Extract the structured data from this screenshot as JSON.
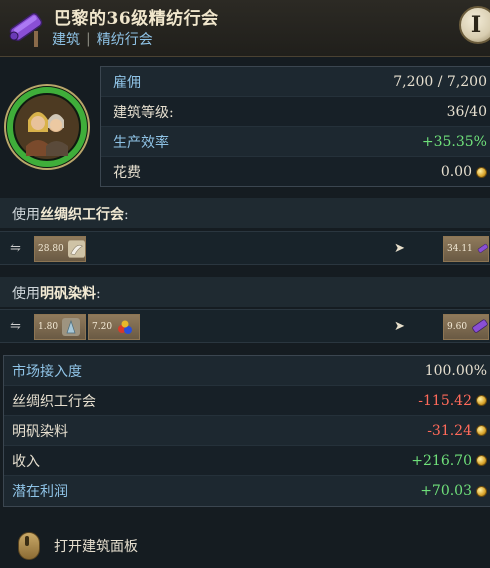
{
  "header": {
    "title": "巴黎的36级精纺行会",
    "crumb1": "建筑",
    "crumb_sep": "|",
    "crumb2": "精纺行会",
    "info_label": "I"
  },
  "stats": [
    {
      "label": "雇佣",
      "value": "7,200 / 7,200"
    },
    {
      "label": "建筑等级:",
      "value": "36/40"
    },
    {
      "label": "生产效率",
      "value": "+35.35%"
    },
    {
      "label": "花费",
      "value": "0.00"
    }
  ],
  "sections": {
    "silk": {
      "prefix": "使用",
      "name": "丝绸织工行会",
      "suffix": ":"
    },
    "alum": {
      "prefix": "使用",
      "name": "明矾染料",
      "suffix": ":"
    }
  },
  "silk_row": {
    "input1": "28.80",
    "output": "34.11"
  },
  "alum_row": {
    "input1": "1.80",
    "input2": "7.20",
    "output": "9.60"
  },
  "finance": [
    {
      "label": "市场接入度",
      "value": "100.00%"
    },
    {
      "label": "丝绸织工行会",
      "value": "-115.42"
    },
    {
      "label": "明矾染料",
      "value": "-31.24"
    },
    {
      "label": "收入",
      "value": "+216.70"
    },
    {
      "label": "潜在利润",
      "value": "+70.03"
    }
  ],
  "footer": {
    "label": "打开建筑面板"
  },
  "colors": {
    "label_blue": "#8fc3e6",
    "positive": "#6fe07a",
    "negative": "#ff6a5a",
    "background": "#151c21"
  }
}
